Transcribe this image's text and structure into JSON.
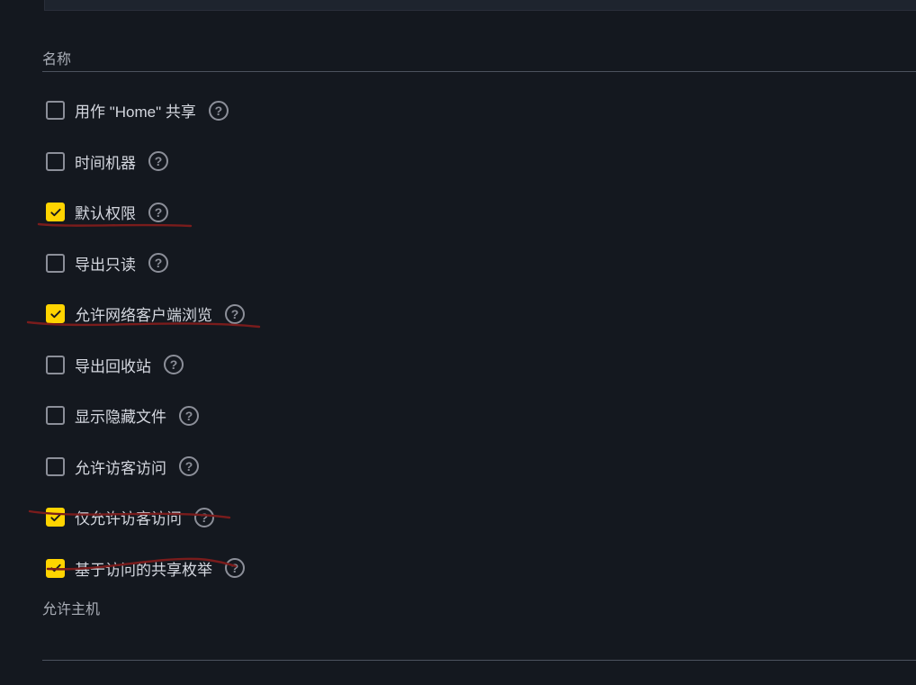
{
  "colors": {
    "accent": "#ffd400",
    "annotation": "#7a1c1c",
    "text": "#c8cbd3"
  },
  "section": {
    "name_label": "名称",
    "allow_hosts_label": "允许主机"
  },
  "options": [
    {
      "id": "use-as-home-share",
      "label": "用作 \"Home\" 共享",
      "checked": false
    },
    {
      "id": "time-machine",
      "label": "时间机器",
      "checked": false
    },
    {
      "id": "default-permissions",
      "label": "默认权限",
      "checked": true
    },
    {
      "id": "export-read-only",
      "label": "导出只读",
      "checked": false
    },
    {
      "id": "allow-network-clients-browse",
      "label": "允许网络客户端浏览",
      "checked": true
    },
    {
      "id": "export-recycle-bin",
      "label": "导出回收站",
      "checked": false
    },
    {
      "id": "show-hidden-files",
      "label": "显示隐藏文件",
      "checked": false
    },
    {
      "id": "allow-guest-access",
      "label": "允许访客访问",
      "checked": false
    },
    {
      "id": "guest-access-only",
      "label": "仅允许访客访问",
      "checked": true
    },
    {
      "id": "access-based-share-enum",
      "label": "基于访问的共享枚举",
      "checked": true
    }
  ],
  "help_glyph": "?"
}
